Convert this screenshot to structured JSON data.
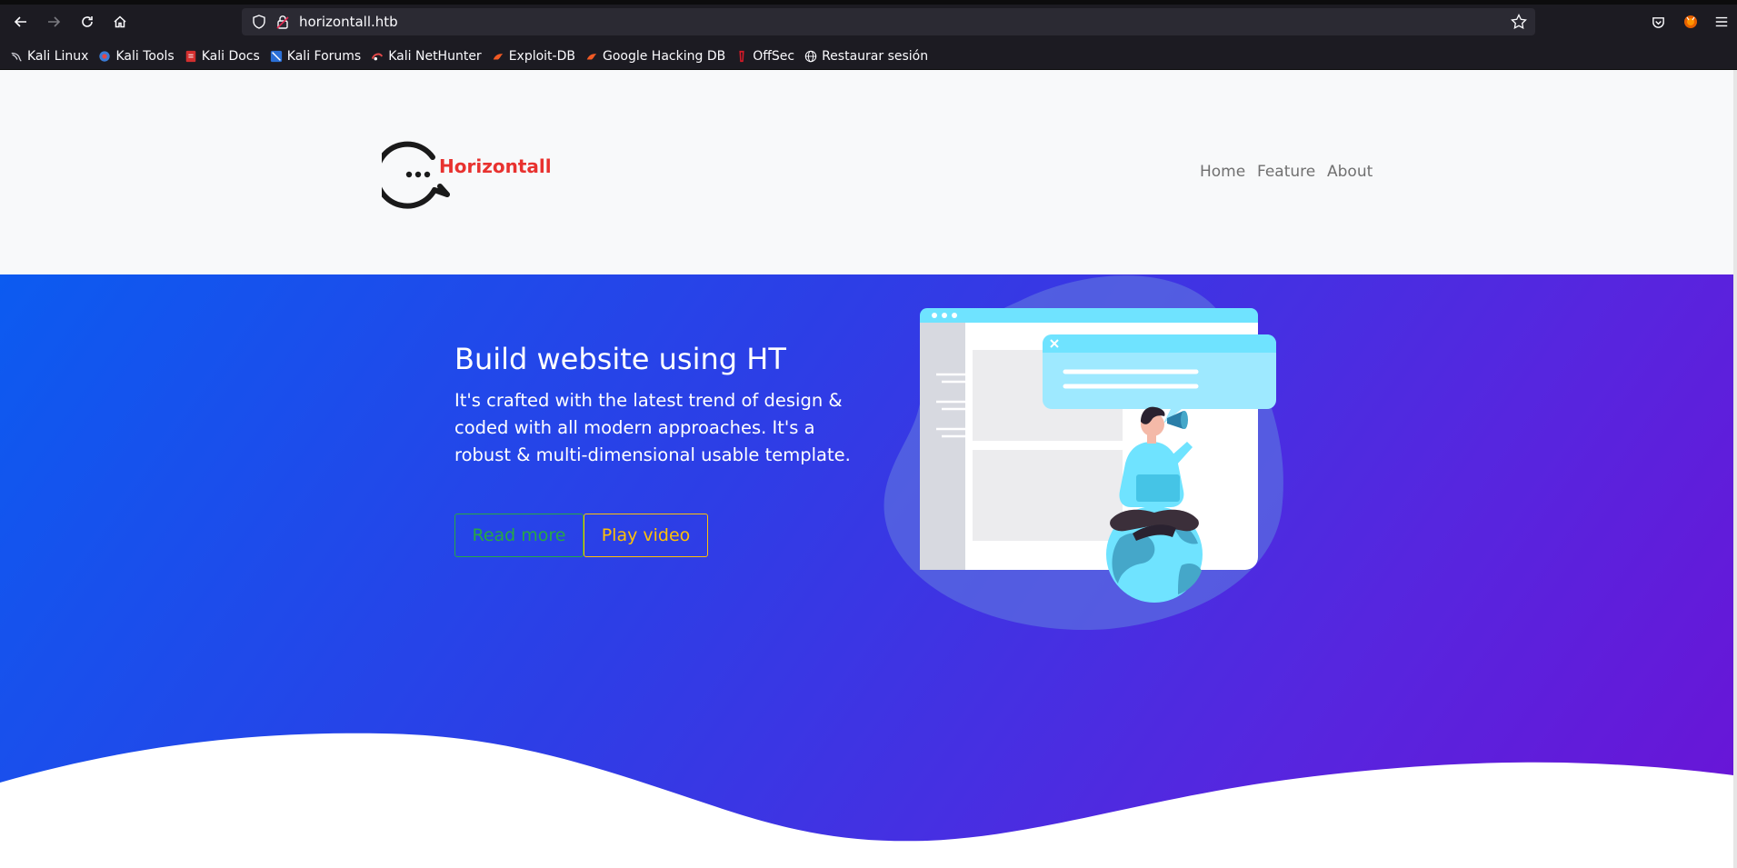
{
  "browser": {
    "url": "horizontall.htb",
    "bookmarks": [
      {
        "label": "Kali Linux",
        "icon": "kali-dragon-icon"
      },
      {
        "label": "Kali Tools",
        "icon": "kali-tools-icon"
      },
      {
        "label": "Kali Docs",
        "icon": "kali-docs-icon"
      },
      {
        "label": "Kali Forums",
        "icon": "kali-forums-icon"
      },
      {
        "label": "Kali NetHunter",
        "icon": "kali-nethunter-icon"
      },
      {
        "label": "Exploit-DB",
        "icon": "exploit-db-icon"
      },
      {
        "label": "Google Hacking DB",
        "icon": "ghdb-icon"
      },
      {
        "label": "OffSec",
        "icon": "offsec-icon"
      },
      {
        "label": "Restaurar sesión",
        "icon": "globe-icon"
      }
    ]
  },
  "site": {
    "brand": "Horizontall",
    "nav": [
      {
        "label": "Home"
      },
      {
        "label": "Feature"
      },
      {
        "label": "About"
      }
    ]
  },
  "hero": {
    "title": "Build website using HT",
    "text": "It's crafted with the latest trend of design & coded with all modern approaches. It's a robust & multi-dimensional usable template.",
    "read_more": "Read more",
    "play_video": "Play video"
  },
  "colors": {
    "brand_red": "#e8322f",
    "gradient_start": "#0c5bf0",
    "gradient_end": "#6a14d6",
    "read_more": "#28a745",
    "play_video": "#ffc107"
  }
}
